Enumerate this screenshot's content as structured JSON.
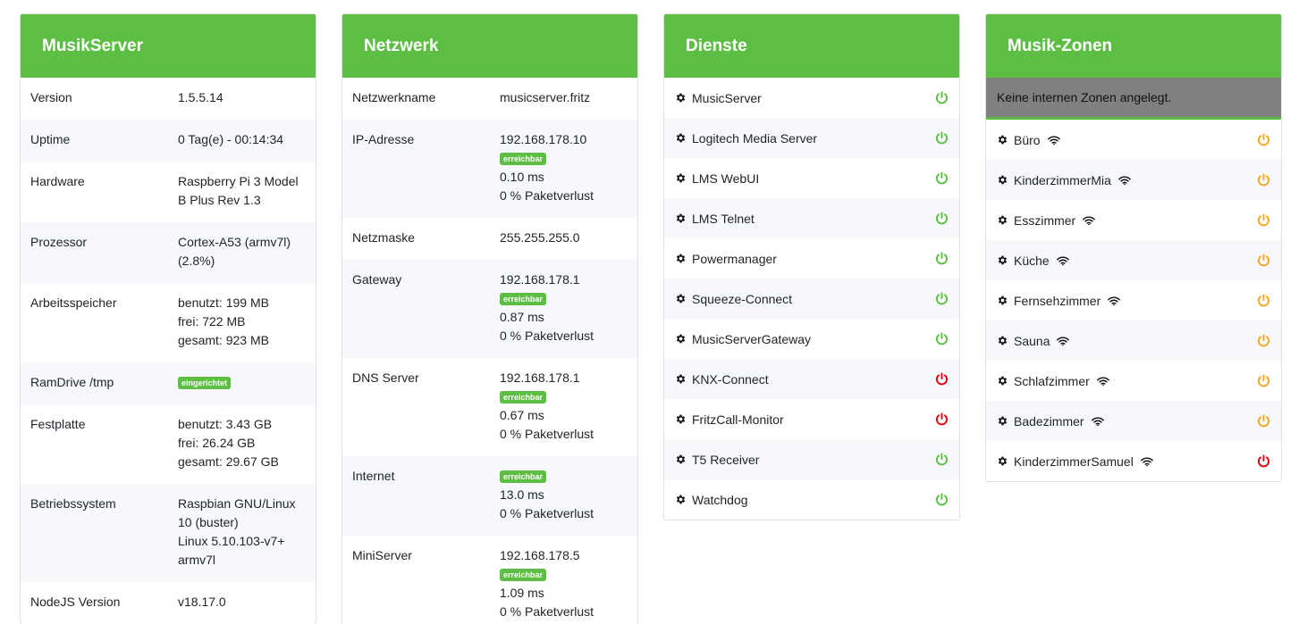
{
  "colors": {
    "accent": "#5cbf44",
    "power_on": "#5cbf44",
    "power_off": "#e3000b",
    "power_standby": "#f5a623"
  },
  "musikserver": {
    "title": "MusikServer",
    "rows": [
      {
        "label": "Version",
        "lines": [
          "1.5.5.14"
        ]
      },
      {
        "label": "Uptime",
        "lines": [
          "0 Tag(e) - 00:14:34"
        ]
      },
      {
        "label": "Hardware",
        "lines": [
          "Raspberry Pi 3 Model",
          "B Plus Rev 1.3"
        ]
      },
      {
        "label": "Prozessor",
        "lines": [
          "Cortex-A53 (armv7l)",
          "(2.8%)"
        ]
      },
      {
        "label": "Arbeitsspeicher",
        "lines": [
          "benutzt: 199 MB",
          "frei: 722 MB",
          "gesamt: 923 MB"
        ]
      },
      {
        "label": "RamDrive /tmp",
        "badge": "eingerichtet",
        "lines": []
      },
      {
        "label": "Festplatte",
        "lines": [
          "benutzt: 3.43 GB",
          "frei: 26.24 GB",
          "gesamt: 29.67 GB"
        ]
      },
      {
        "label": "Betriebssystem",
        "lines": [
          "Raspbian GNU/Linux",
          "10 (buster)",
          "Linux 5.10.103-v7+",
          "armv7l"
        ]
      },
      {
        "label": "NodeJS Version",
        "lines": [
          "v18.17.0"
        ]
      }
    ]
  },
  "netzwerk": {
    "title": "Netzwerk",
    "rows": [
      {
        "label": "Netzwerkname",
        "lines": [
          "musicserver.fritz"
        ]
      },
      {
        "label": "IP-Adresse",
        "lines": [
          "192.168.178.10"
        ],
        "badge": "erreichbar",
        "after": [
          "0.10 ms",
          "0 % Paketverlust"
        ]
      },
      {
        "label": "Netzmaske",
        "lines": [
          "255.255.255.0"
        ]
      },
      {
        "label": "Gateway",
        "lines": [
          "192.168.178.1"
        ],
        "badge": "erreichbar",
        "after": [
          "0.87 ms",
          "0 % Paketverlust"
        ]
      },
      {
        "label": "DNS Server",
        "lines": [
          "192.168.178.1"
        ],
        "badge": "erreichbar",
        "after": [
          "0.67 ms",
          "0 % Paketverlust"
        ]
      },
      {
        "label": "Internet",
        "lines": [],
        "badge": "erreichbar",
        "after": [
          "13.0 ms",
          "0 % Paketverlust"
        ]
      },
      {
        "label": "MiniServer",
        "lines": [
          "192.168.178.5"
        ],
        "badge": "erreichbar",
        "after": [
          "1.09 ms",
          "0 % Paketverlust"
        ]
      }
    ]
  },
  "dienste": {
    "title": "Dienste",
    "items": [
      {
        "name": "MusicServer",
        "status": "on"
      },
      {
        "name": "Logitech Media Server",
        "status": "on"
      },
      {
        "name": "LMS WebUI",
        "status": "on"
      },
      {
        "name": "LMS Telnet",
        "status": "on"
      },
      {
        "name": "Powermanager",
        "status": "on"
      },
      {
        "name": "Squeeze-Connect",
        "status": "on"
      },
      {
        "name": "MusicServerGateway",
        "status": "on"
      },
      {
        "name": "KNX-Connect",
        "status": "off"
      },
      {
        "name": "FritzCall-Monitor",
        "status": "off"
      },
      {
        "name": "T5 Receiver",
        "status": "on"
      },
      {
        "name": "Watchdog",
        "status": "on"
      }
    ]
  },
  "zonen": {
    "title": "Musik-Zonen",
    "message": "Keine internen Zonen angelegt.",
    "items": [
      {
        "name": "Büro",
        "status": "standby"
      },
      {
        "name": "KinderzimmerMia",
        "status": "standby"
      },
      {
        "name": "Esszimmer",
        "status": "standby"
      },
      {
        "name": "Küche",
        "status": "standby"
      },
      {
        "name": "Fernsehzimmer",
        "status": "standby"
      },
      {
        "name": "Sauna",
        "status": "standby"
      },
      {
        "name": "Schlafzimmer",
        "status": "standby"
      },
      {
        "name": "Badezimmer",
        "status": "standby"
      },
      {
        "name": "KinderzimmerSamuel",
        "status": "off"
      }
    ]
  }
}
